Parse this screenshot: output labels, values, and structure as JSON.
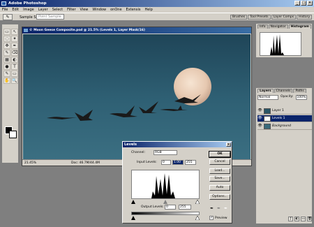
{
  "app": {
    "title": "Adobe Photoshop"
  },
  "window_buttons": [
    "_",
    "□",
    "×"
  ],
  "menu": [
    "File",
    "Edit",
    "Image",
    "Layer",
    "Select",
    "Filter",
    "View",
    "Window",
    "onOne",
    "Extensis",
    "Help"
  ],
  "options": {
    "sample_size_label": "Sample Size:",
    "sample_size_value": "Point Sample",
    "tool_glyph": "✎",
    "palette_tabs": [
      "Brushes",
      "Tool Presets",
      "Layer Comps",
      "History"
    ]
  },
  "tools": [
    "▭",
    "↖",
    "◌",
    "✦",
    "✥",
    "✒",
    "✎",
    "⌫",
    "▦",
    "◐",
    "●",
    "T",
    "✎",
    "▭",
    "✋",
    "🔍"
  ],
  "document": {
    "title": "© Moon Geese Composite.psd @ 21.5% (Levels 1, Layer Mask/16)",
    "zoom": "21.45%",
    "doc_size": "Doc: 46.7M/44.4M"
  },
  "histogram": {
    "tabs": [
      "Info",
      "Navigator",
      "Histogram"
    ],
    "active": "Histogram"
  },
  "layers": {
    "tabs": [
      "Layers",
      "Channels",
      "Paths"
    ],
    "blend_mode": "Normal",
    "opacity_label": "Opacity:",
    "opacity": "100%",
    "items": [
      {
        "name": "Layer 1",
        "selected": false,
        "thumb": "#2a5566"
      },
      {
        "name": "Levels 1",
        "selected": true,
        "thumb": "#ffffff"
      },
      {
        "name": "Background",
        "selected": false,
        "thumb": "#3a6a7a"
      }
    ],
    "footer_icons": [
      "ƒ",
      "◐",
      "▭",
      "🗑"
    ]
  },
  "levels": {
    "title": "Levels",
    "close": "×",
    "channel_label": "Channel:",
    "channel": "RGB",
    "input_label": "Input Levels:",
    "input": [
      "0",
      "1.00",
      "255"
    ],
    "output_label": "Output Levels:",
    "output": [
      "0",
      "255"
    ],
    "buttons": [
      "OK",
      "Cancel",
      "Load...",
      "Save...",
      "Auto",
      "Options..."
    ],
    "preview_label": "Preview",
    "preview_checked": true
  }
}
